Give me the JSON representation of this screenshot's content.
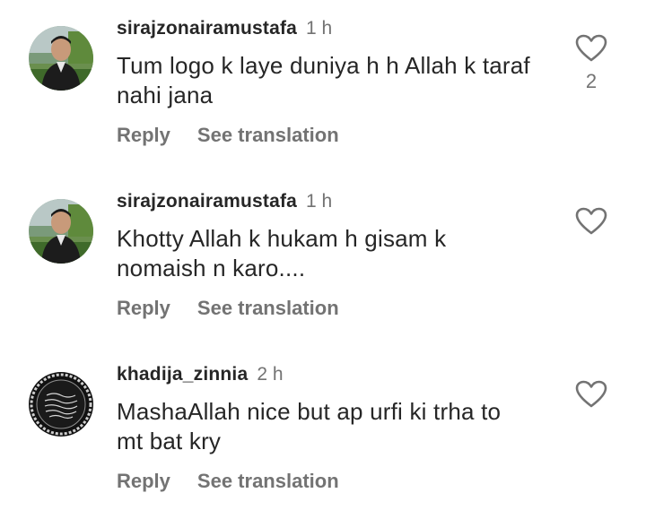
{
  "comments": [
    {
      "username": "sirajzonairamustafa",
      "time": "1 h",
      "text": "Tum logo k laye duniya h h Allah k taraf\nnahi jana",
      "like_count": "2",
      "reply_label": "Reply",
      "translate_label": "See translation"
    },
    {
      "username": "sirajzonairamustafa",
      "time": "1 h",
      "text": "Khotty  Allah k hukam h gisam k\nnomaish  n karo....",
      "reply_label": "Reply",
      "translate_label": "See translation"
    },
    {
      "username": "khadija_zinnia",
      "time": "2 h",
      "text": "MashaAllah nice but ap urfi ki trha to\nmt bat kry",
      "reply_label": "Reply",
      "translate_label": "See translation"
    }
  ],
  "icons": {
    "like": "heart-outline-icon"
  },
  "colors": {
    "text_primary": "#262626",
    "text_secondary": "#737373",
    "background": "#ffffff"
  }
}
